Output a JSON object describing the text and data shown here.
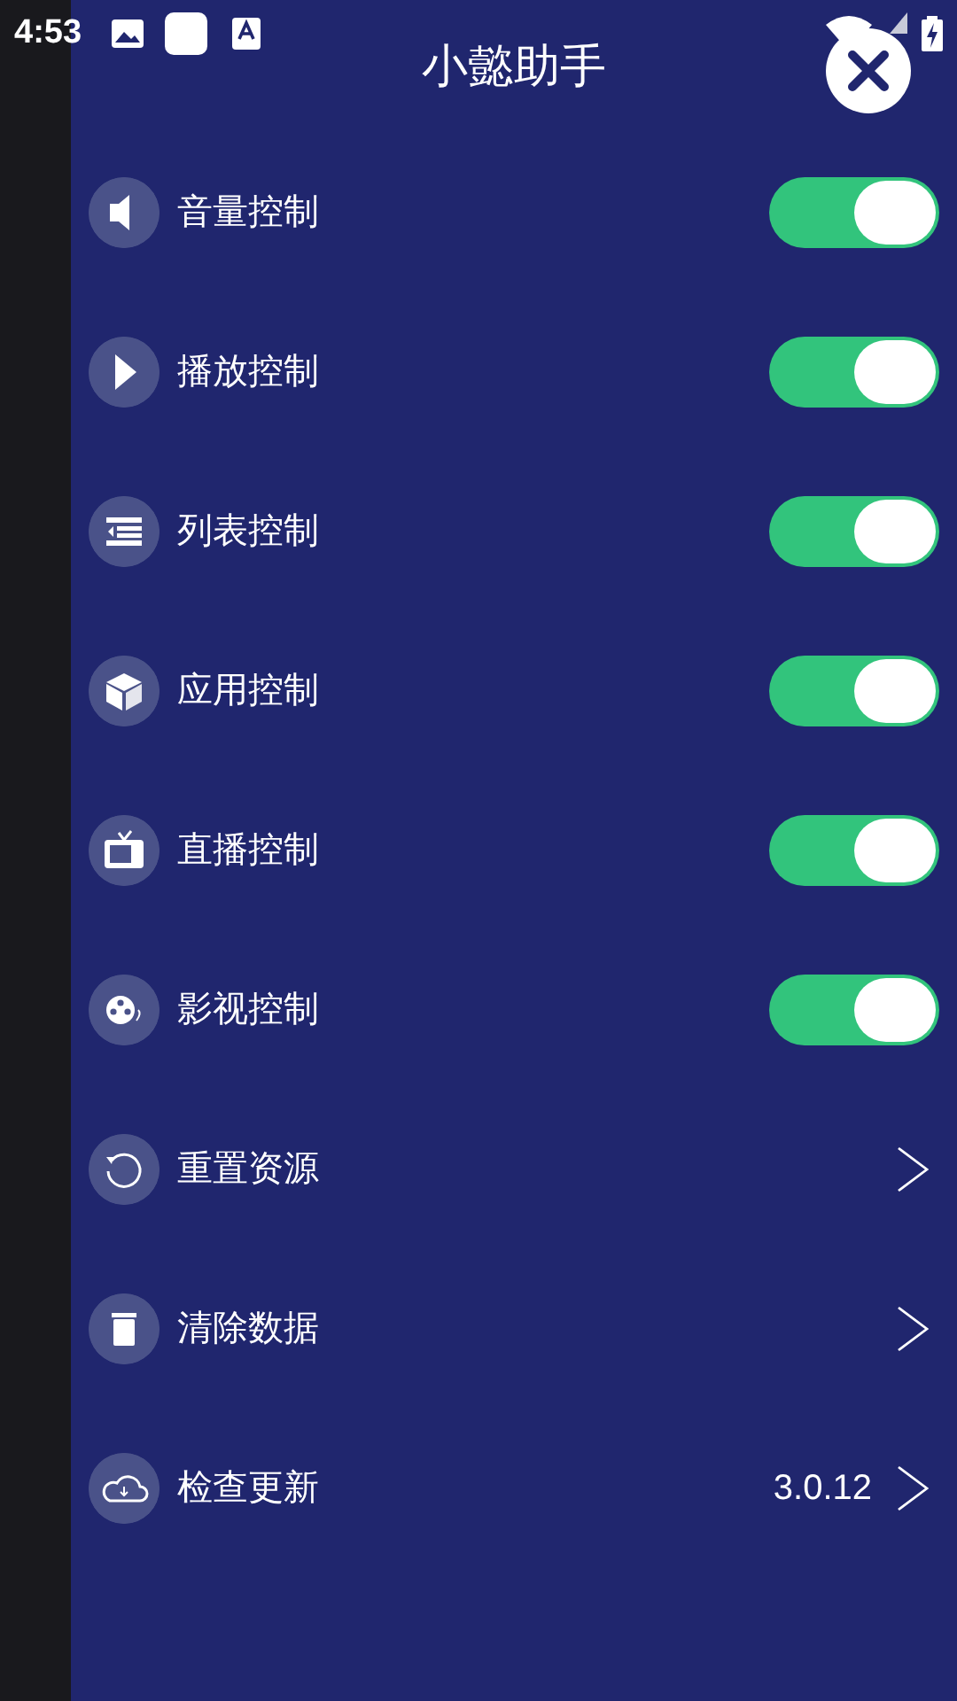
{
  "status_bar": {
    "time": "4:53"
  },
  "title": "小懿助手",
  "items": [
    {
      "kind": "toggle",
      "label": "音量控制",
      "on": true
    },
    {
      "kind": "toggle",
      "label": "播放控制",
      "on": true
    },
    {
      "kind": "toggle",
      "label": "列表控制",
      "on": true
    },
    {
      "kind": "toggle",
      "label": "应用控制",
      "on": true
    },
    {
      "kind": "toggle",
      "label": "直播控制",
      "on": true
    },
    {
      "kind": "toggle",
      "label": "影视控制",
      "on": true
    },
    {
      "kind": "link",
      "label": "重置资源"
    },
    {
      "kind": "link",
      "label": "清除数据"
    },
    {
      "kind": "link",
      "label": "检查更新",
      "value": "3.0.12"
    }
  ]
}
